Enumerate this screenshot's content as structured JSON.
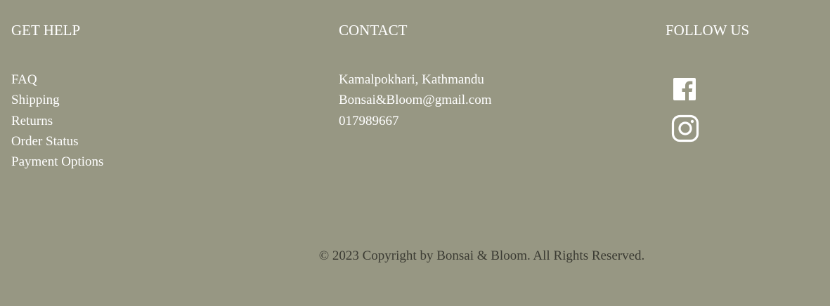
{
  "help": {
    "title": "GET HELP",
    "links": [
      "FAQ",
      "Shipping",
      "Returns",
      "Order Status",
      "Payment Options"
    ]
  },
  "contact": {
    "title": "CONTACT",
    "address": "Kamalpokhari, Kathmandu",
    "email": "Bonsai&Bloom@gmail.com",
    "phone": "017989667"
  },
  "follow": {
    "title": "FOLLOW US",
    "icons": [
      "facebook-icon",
      "instagram-icon"
    ]
  },
  "copyright": "© 2023 Copyright by Bonsai & Bloom. All Rights Reserved.",
  "colors": {
    "background": "#979783",
    "text": "#ffffff",
    "copyright_text": "#3b3b33"
  }
}
